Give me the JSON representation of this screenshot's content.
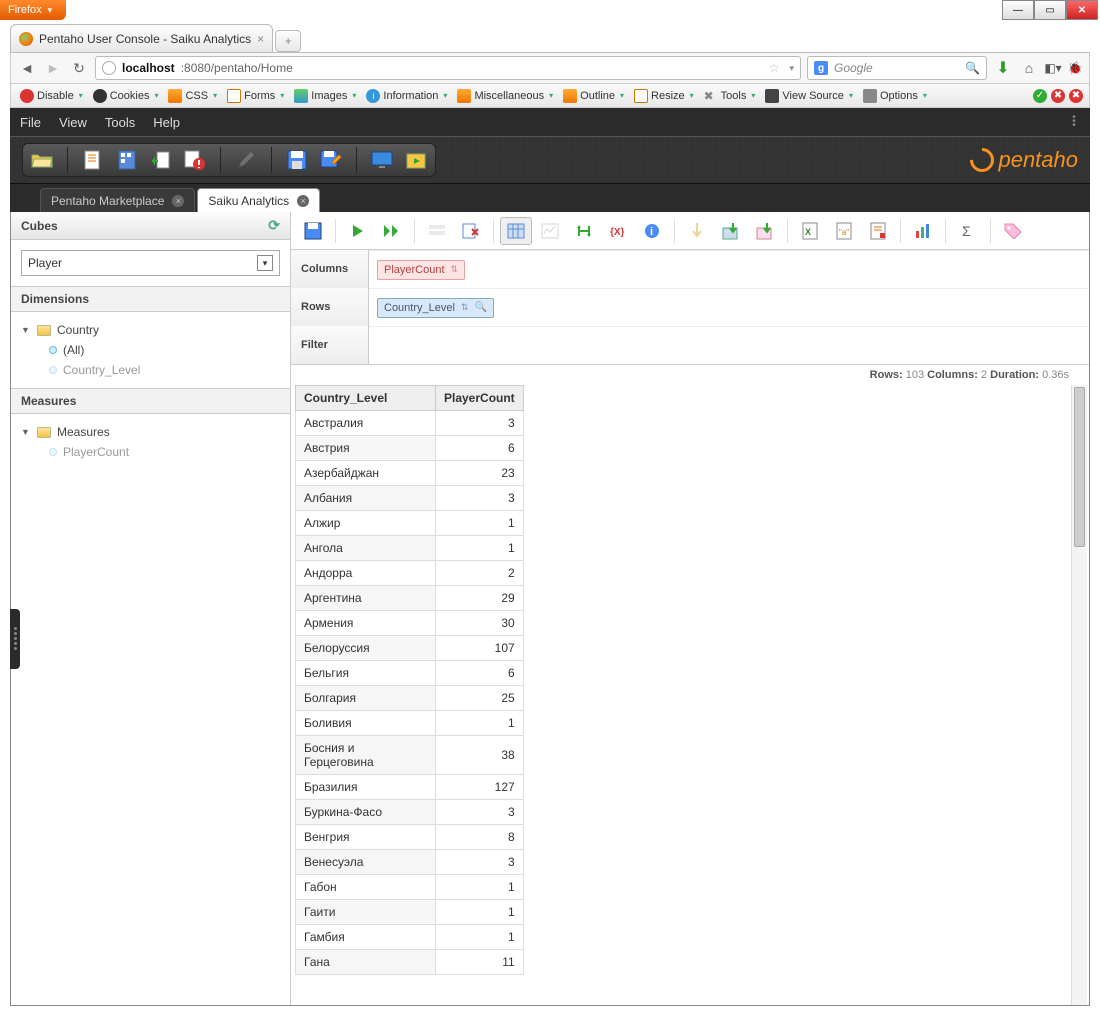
{
  "browser": {
    "name": "Firefox",
    "tab_title": "Pentaho User Console - Saiku Analytics",
    "url_host": "localhost",
    "url_port_path": ":8080/pentaho/Home",
    "search_placeholder": "Google",
    "dev_toolbar": [
      "Disable",
      "Cookies",
      "CSS",
      "Forms",
      "Images",
      "Information",
      "Miscellaneous",
      "Outline",
      "Resize",
      "Tools",
      "View Source",
      "Options"
    ]
  },
  "app_menu": [
    "File",
    "View",
    "Tools",
    "Help"
  ],
  "app_tabs": [
    {
      "label": "Pentaho Marketplace",
      "active": false
    },
    {
      "label": "Saiku Analytics",
      "active": true
    }
  ],
  "pentaho_brand": "pentaho",
  "left": {
    "cubes_header": "Cubes",
    "cube_selected": "Player",
    "dimensions_header": "Dimensions",
    "dim_tree": {
      "label": "Country",
      "children": [
        {
          "label": "(All)"
        },
        {
          "label": "Country_Level",
          "dim": true
        }
      ]
    },
    "measures_header": "Measures",
    "measures_tree": {
      "label": "Measures",
      "children": [
        {
          "label": "PlayerCount",
          "dim": true
        }
      ]
    }
  },
  "axes": {
    "columns_label": "Columns",
    "columns_chip": "PlayerCount",
    "rows_label": "Rows",
    "rows_chip": "Country_Level",
    "filter_label": "Filter"
  },
  "stats": {
    "rows_label": "Rows:",
    "rows": "103",
    "cols_label": "Columns:",
    "cols": "2",
    "dur_label": "Duration:",
    "dur": "0.36s"
  },
  "table": {
    "headers": [
      "Country_Level",
      "PlayerCount"
    ],
    "rows": [
      [
        "Австралия",
        "3"
      ],
      [
        "Австрия",
        "6"
      ],
      [
        "Азербайджан",
        "23"
      ],
      [
        "Албания",
        "3"
      ],
      [
        "Алжир",
        "1"
      ],
      [
        "Ангола",
        "1"
      ],
      [
        "Андорра",
        "2"
      ],
      [
        "Аргентина",
        "29"
      ],
      [
        "Армения",
        "30"
      ],
      [
        "Белоруссия",
        "107"
      ],
      [
        "Бельгия",
        "6"
      ],
      [
        "Болгария",
        "25"
      ],
      [
        "Боливия",
        "1"
      ],
      [
        "Босния и Герцеговина",
        "38"
      ],
      [
        "Бразилия",
        "127"
      ],
      [
        "Буркина-Фасо",
        "3"
      ],
      [
        "Венгрия",
        "8"
      ],
      [
        "Венесуэла",
        "3"
      ],
      [
        "Габон",
        "1"
      ],
      [
        "Гаити",
        "1"
      ],
      [
        "Гамбия",
        "1"
      ],
      [
        "Гана",
        "11"
      ]
    ]
  }
}
